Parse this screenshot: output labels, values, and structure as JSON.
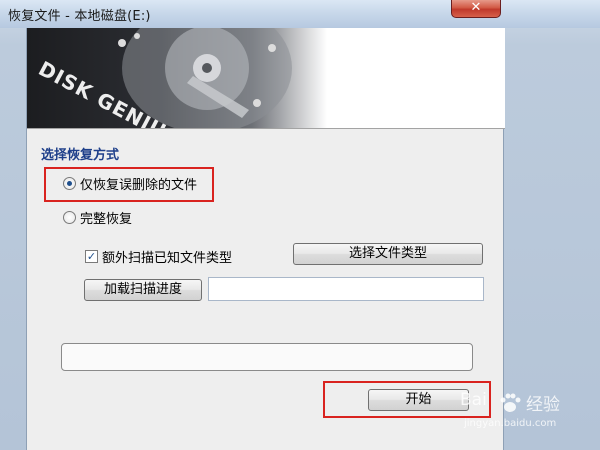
{
  "window": {
    "title": "恢复文件 - 本地磁盘(E:)",
    "close_glyph": "✕"
  },
  "banner": {
    "logo_text": "DISK GENIUS"
  },
  "recover_mode": {
    "label": "选择恢复方式",
    "options": [
      {
        "label": "仅恢复误删除的文件",
        "selected": true
      },
      {
        "label": "完整恢复",
        "selected": false
      }
    ],
    "extra_scan": {
      "label": "额外扫描已知文件类型",
      "checked": true
    },
    "select_types_button": "选择文件类型",
    "load_progress_button": "加载扫描进度",
    "scan_progress_path": "",
    "status_text": ""
  },
  "start_button": "开始",
  "watermark": {
    "brand": "Bai",
    "brand_tail": "经验",
    "url": "jingyan.baidu.com"
  },
  "colors": {
    "highlight_box": "#d9231f",
    "group_label": "#1e3f8a",
    "close_button": "#c0392b"
  }
}
